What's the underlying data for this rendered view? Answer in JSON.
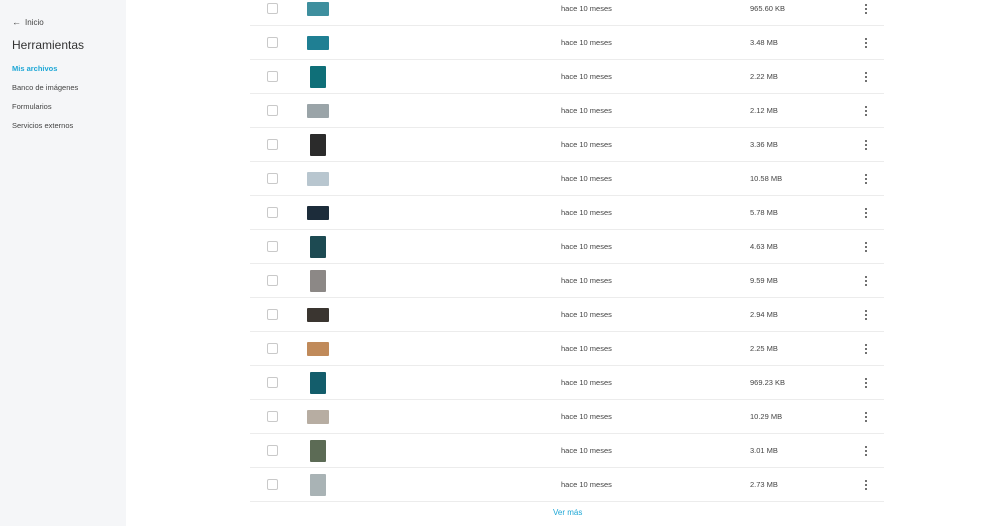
{
  "sidebar": {
    "back_label": "Inicio",
    "title": "Herramientas",
    "items": [
      {
        "label": "Mis archivos",
        "active": true
      },
      {
        "label": "Banco de imágenes",
        "active": false
      },
      {
        "label": "Formularios",
        "active": false
      },
      {
        "label": "Servicios externos",
        "active": false
      }
    ]
  },
  "files": [
    {
      "date": "hace 10 meses",
      "size": "965.60 KB",
      "thumb": "#3e8f9e"
    },
    {
      "date": "hace 10 meses",
      "size": "3.48 MB",
      "thumb": "#1f7f93"
    },
    {
      "date": "hace 10 meses",
      "size": "2.22 MB",
      "thumb": "#0f6f78",
      "tall": true
    },
    {
      "date": "hace 10 meses",
      "size": "2.12 MB",
      "thumb": "#9aa4a8"
    },
    {
      "date": "hace 10 meses",
      "size": "3.36 MB",
      "thumb": "#2b2b2b",
      "tall": true
    },
    {
      "date": "hace 10 meses",
      "size": "10.58 MB",
      "thumb": "#b8c6cf"
    },
    {
      "date": "hace 10 meses",
      "size": "5.78 MB",
      "thumb": "#1c2c3a"
    },
    {
      "date": "hace 10 meses",
      "size": "4.63 MB",
      "thumb": "#1d4a52",
      "tall": true
    },
    {
      "date": "hace 10 meses",
      "size": "9.59 MB",
      "thumb": "#8c8886",
      "tall": true
    },
    {
      "date": "hace 10 meses",
      "size": "2.94 MB",
      "thumb": "#3a3530"
    },
    {
      "date": "hace 10 meses",
      "size": "2.25 MB",
      "thumb": "#c08a5a"
    },
    {
      "date": "hace 10 meses",
      "size": "969.23 KB",
      "thumb": "#135d6b",
      "tall": true
    },
    {
      "date": "hace 10 meses",
      "size": "10.29 MB",
      "thumb": "#b7ada2"
    },
    {
      "date": "hace 10 meses",
      "size": "3.01 MB",
      "thumb": "#5c6b55",
      "tall": true
    },
    {
      "date": "hace 10 meses",
      "size": "2.73 MB",
      "thumb": "#a9b3b5",
      "tall": true
    }
  ],
  "load_more": "Ver más",
  "colors": {
    "accent": "#1ea7d6",
    "sidebar_bg": "#f5f6f8"
  }
}
